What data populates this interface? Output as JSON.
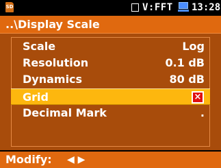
{
  "status_bar": {
    "sd_label": "SD",
    "mode": "V:FFT",
    "time": "13:28"
  },
  "title": "..\\Display Scale",
  "menu": {
    "items": [
      {
        "label": "Scale",
        "value": "Log"
      },
      {
        "label": "Resolution",
        "value": "0.1 dB"
      },
      {
        "label": "Dynamics",
        "value": "80 dB"
      },
      {
        "label": "Grid",
        "value": "×",
        "selected": true
      },
      {
        "label": "Decimal Mark",
        "value": "."
      }
    ]
  },
  "footer": {
    "modify_label": "Modify:",
    "arrows": "◀ ▶"
  },
  "colors": {
    "title_bar": "#e0690f",
    "menu_background": "#a84c0b",
    "selection": "#fdb70e",
    "checkbox_mark": "#e01010",
    "battery": "#4a8dff"
  }
}
